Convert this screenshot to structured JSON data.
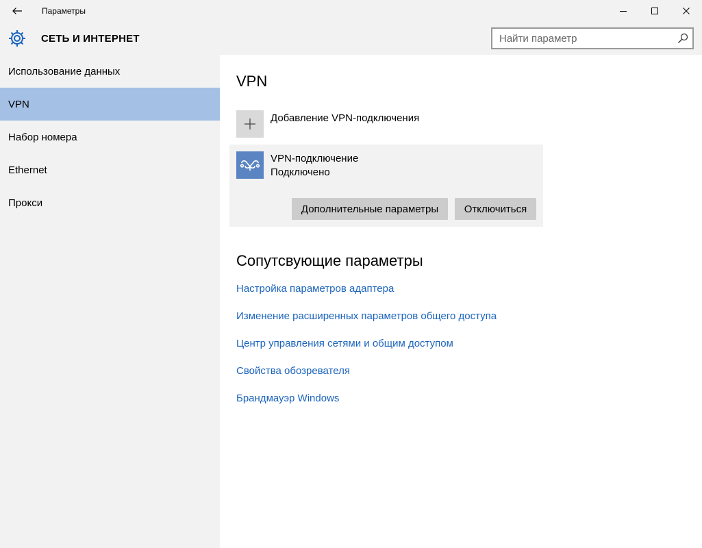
{
  "window": {
    "title": "Параметры"
  },
  "header": {
    "section_title": "СЕТЬ И ИНТЕРНЕТ",
    "search_placeholder": "Найти параметр"
  },
  "sidebar": {
    "selected_index": 1,
    "items": [
      {
        "label": "Использование данных"
      },
      {
        "label": "VPN"
      },
      {
        "label": "Набор номера"
      },
      {
        "label": "Ethernet"
      },
      {
        "label": "Прокси"
      }
    ]
  },
  "main": {
    "title": "VPN",
    "add_vpn_label": "Добавление VPN-подключения",
    "connection": {
      "name": "VPN-подключение",
      "status": "Подключено",
      "advanced_button": "Дополнительные параметры",
      "disconnect_button": "Отключиться"
    },
    "related_title": "Сопутсвующие параметры",
    "related_links": [
      {
        "label": "Настройка параметров адаптера"
      },
      {
        "label": "Изменение расширенных параметров общего доступа"
      },
      {
        "label": "Центр управления сетями и общим доступом"
      },
      {
        "label": "Свойства обозревателя"
      },
      {
        "label": "Брандмауэр Windows"
      }
    ]
  },
  "colors": {
    "accent": "#a5c0e5",
    "link": "#1a63bd",
    "vpn_tile": "#5a84c2",
    "chrome_bg": "#f2f2f2"
  },
  "icons": {
    "back": "arrow-left-icon",
    "settings": "gear-icon",
    "search": "search-icon",
    "add": "plus-icon",
    "vpn": "vpn-link-icon",
    "minimize": "minimize-icon",
    "maximize": "maximize-icon",
    "close": "close-icon"
  }
}
